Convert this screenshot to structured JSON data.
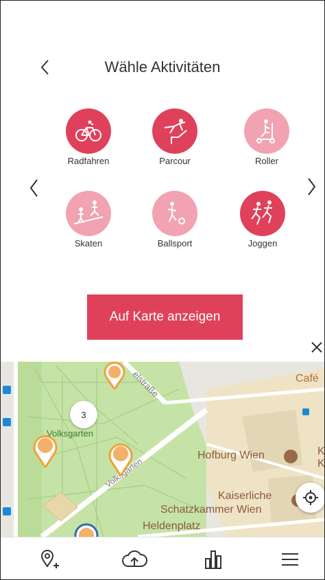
{
  "header": {
    "title": "Wähle Aktivitäten"
  },
  "activities": [
    {
      "label": "Radfahren",
      "selected": true,
      "icon": "bicycle-icon"
    },
    {
      "label": "Parcour",
      "selected": true,
      "icon": "parkour-icon"
    },
    {
      "label": "Roller",
      "selected": false,
      "icon": "scooter-icon"
    },
    {
      "label": "Skaten",
      "selected": false,
      "icon": "skateboard-icon"
    },
    {
      "label": "Ballsport",
      "selected": false,
      "icon": "ball-sport-icon"
    },
    {
      "label": "Joggen",
      "selected": true,
      "icon": "running-icon"
    }
  ],
  "cta": {
    "label": "Auf Karte anzeigen"
  },
  "map": {
    "cluster_count": "3",
    "labels": {
      "volksgarten_area": "Volksgarten",
      "volksgarten_street": "Volksgarten",
      "street_top": "elstraße",
      "hofburg": "Hofburg Wien",
      "kaiserliche_1": "Kaiserliche",
      "kaiserliche_2": "Schatzkammer Wien",
      "heldenplatz": "Heldenplatz",
      "cafe": "Café",
      "edge_k1": "K",
      "edge_k2": "K"
    }
  },
  "colors": {
    "accent": "#e0415a",
    "accent_light": "#f1a3b1",
    "park": "#c5e3a6",
    "map_bg": "#e8e6e1",
    "poi_brown": "#9a6a48"
  }
}
